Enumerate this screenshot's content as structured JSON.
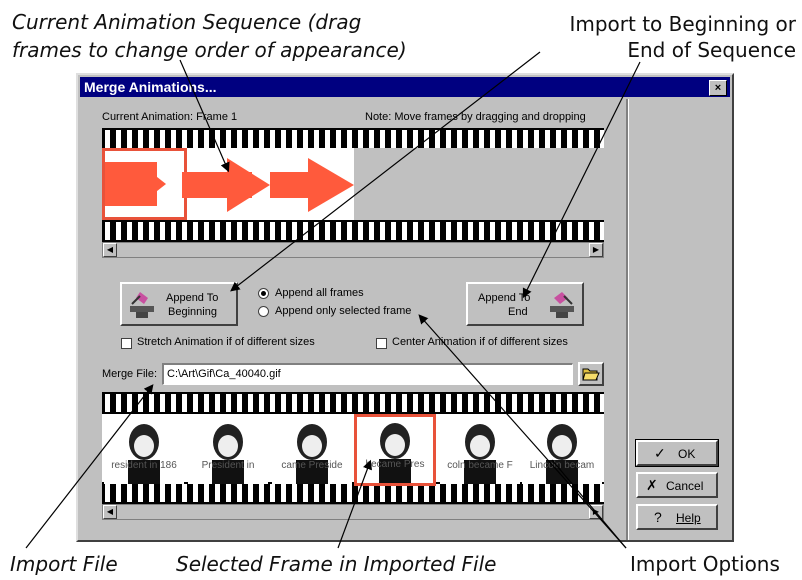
{
  "callouts": {
    "current_seq_line1": "Current Animation Sequence (drag",
    "current_seq_line2": "frames to change order of appearance)",
    "import_to_line1": "Import to Beginning or",
    "import_to_line2": "End of Sequence",
    "import_file": "Import File",
    "selected_frame": "Selected Frame in Imported File",
    "import_options": "Import Options"
  },
  "dialog": {
    "title": "Merge Animations...",
    "close_glyph": "×",
    "current_animation_label": "Current Animation:  Frame 1",
    "note_label": "Note: Move frames by dragging and dropping",
    "append_beginning": {
      "line1": "Append To",
      "line2": "Beginning"
    },
    "append_end": {
      "line1": "Append To",
      "line2": "End"
    },
    "radio_all": "Append all frames",
    "radio_selected": "Append only selected frame",
    "stretch_label": "Stretch Animation if of different sizes",
    "center_label": "Center Animation if of different sizes",
    "merge_file_label": "Merge File:",
    "merge_file_value": "C:\\Art\\Gif\\Ca_40040.gif",
    "ok_label": "OK",
    "cancel_label": "Cancel",
    "help_label": "Help",
    "frame_captions": [
      "resident in 186",
      "President in ",
      "came Preside",
      "became Pres",
      "coln became F",
      "Lincoln becam"
    ]
  },
  "colors": {
    "titlebar": "#000080",
    "arrow_red": "#ff5a3c",
    "selection": "#e8523a",
    "dialog_gray": "#c0c0c0"
  }
}
